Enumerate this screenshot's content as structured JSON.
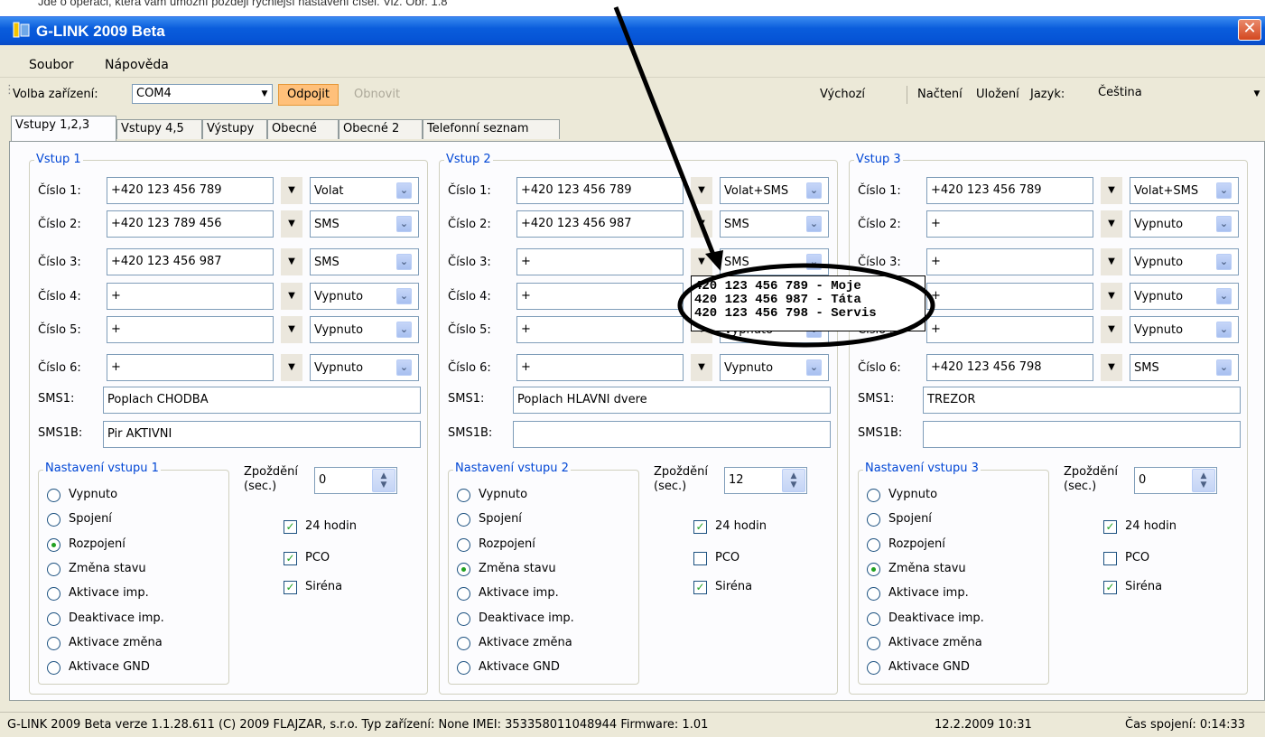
{
  "caption_text": "Jde o operaci, která vám umožní později rychlejší nastavení čísel. Viz. Obr. 1.8",
  "window": {
    "title": "G-LINK 2009 Beta",
    "close": "✕"
  },
  "menu": {
    "file": "Soubor",
    "help": "Nápověda"
  },
  "toolbar": {
    "device_label": "Volba zařízení:",
    "device_value": "COM4",
    "disconnect": "Odpojit",
    "refresh": "Obnovit",
    "default": "Výchozí",
    "load": "Načtení",
    "save": "Uložení",
    "language_label": "Jazyk:",
    "language_value": "Čeština"
  },
  "tabs": [
    "Vstupy 1,2,3",
    "Vstupy 4,5",
    "Výstupy",
    "Obecné",
    "Obecné 2",
    "Telefonní seznam"
  ],
  "number_labels": [
    "Číslo 1:",
    "Číslo 2:",
    "Číslo 3:",
    "Číslo 4:",
    "Číslo 5:",
    "Číslo 6:"
  ],
  "sms_labels": {
    "sms1": "SMS1:",
    "sms1b": "SMS1B:"
  },
  "delay_label": {
    "line1": "Zpoždění",
    "line2": "(sec.)"
  },
  "modes": [
    "Vypnuto",
    "Spojení",
    "Rozpojení",
    "Změna stavu",
    "Aktivace imp.",
    "Deaktivace imp.",
    "Aktivace změna",
    "Aktivace GND"
  ],
  "check_labels": {
    "h24": "24 hodin",
    "pco": "PCO",
    "siren": "Siréna"
  },
  "inputs": [
    {
      "title": "Vstup 1",
      "settings_title": "Nastavení vstupu 1",
      "numbers": [
        "+420 123 456 789",
        "+420 123 789 456",
        "+420 123 456 987",
        "+",
        "+",
        "+"
      ],
      "actions": [
        "Volat",
        "SMS",
        "SMS",
        "Vypnuto",
        "Vypnuto",
        "Vypnuto"
      ],
      "sms1": "Poplach CHODBA",
      "sms1b": "Pir AKTIVNI",
      "delay": "0",
      "selected_mode": "Rozpojení",
      "h24": true,
      "pco": true,
      "siren": true
    },
    {
      "title": "Vstup 2",
      "settings_title": "Nastavení vstupu 2",
      "numbers": [
        "+420 123 456 789",
        "+420 123 456 987",
        "+",
        "+",
        "+",
        "+"
      ],
      "actions": [
        "Volat+SMS",
        "SMS",
        "SMS",
        "",
        "Vypnuto",
        "Vypnuto"
      ],
      "sms1": "Poplach HLAVNI dvere",
      "sms1b": "",
      "delay": "12",
      "selected_mode": "Změna stavu",
      "h24": true,
      "pco": false,
      "siren": true
    },
    {
      "title": "Vstup 3",
      "settings_title": "Nastavení vstupu 3",
      "numbers": [
        "+420 123 456 789",
        "+",
        "+",
        "+",
        "+",
        "+420 123 456 798"
      ],
      "actions": [
        "Volat+SMS",
        "Vypnuto",
        "Vypnuto",
        "Vypnuto",
        "Vypnuto",
        "SMS"
      ],
      "sms1": "TREZOR",
      "sms1b": "",
      "delay": "0",
      "selected_mode": "Změna stavu",
      "h24": true,
      "pco": false,
      "siren": true
    }
  ],
  "phonebook_popup": [
    "420 123 456 789  - Moje",
    "420 123 456 987  - Táta",
    "420 123 456 798  - Servis"
  ],
  "status": {
    "app": "G-LINK 2009 Beta verze 1.1.28.611  (C) 2009 FLAJZAR, s.r.o.  Typ zařízení: None  IMEI: 353358011048944  Firmware: 1.01",
    "datetime": "12.2.2009  10:31",
    "conn_time": "Čas spojení: 0:14:33"
  }
}
